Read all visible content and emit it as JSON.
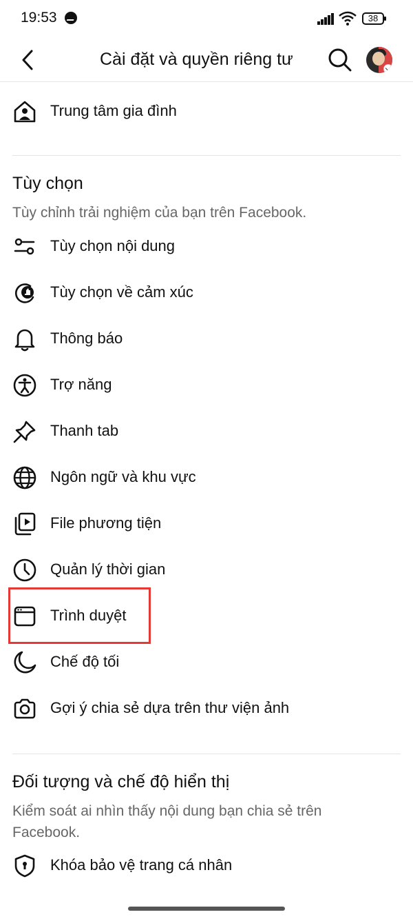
{
  "status_bar": {
    "time": "19:53",
    "battery": "38"
  },
  "header": {
    "title": "Cài đặt và quyền riêng tư"
  },
  "family_center": {
    "label": "Trung tâm gia đình"
  },
  "preferences": {
    "title": "Tùy chọn",
    "description": "Tùy chỉnh trải nghiệm của bạn trên Facebook.",
    "items": [
      {
        "label": "Tùy chọn nội dung",
        "icon": "sliders-icon"
      },
      {
        "label": "Tùy chọn về cảm xúc",
        "icon": "reaction-icon"
      },
      {
        "label": "Thông báo",
        "icon": "bell-icon"
      },
      {
        "label": "Trợ năng",
        "icon": "accessibility-icon"
      },
      {
        "label": "Thanh tab",
        "icon": "pin-icon"
      },
      {
        "label": "Ngôn ngữ và khu vực",
        "icon": "globe-icon"
      },
      {
        "label": "File phương tiện",
        "icon": "media-icon"
      },
      {
        "label": "Quản lý thời gian",
        "icon": "clock-icon"
      },
      {
        "label": "Trình duyệt",
        "icon": "browser-icon"
      },
      {
        "label": "Chế độ tối",
        "icon": "moon-icon"
      },
      {
        "label": "Gợi ý chia sẻ dựa trên thư viện ảnh",
        "icon": "camera-icon"
      }
    ]
  },
  "audience": {
    "title": "Đối tượng và chế độ hiển thị",
    "description": "Kiểm soát ai nhìn thấy nội dung bạn chia sẻ trên Facebook.",
    "items": [
      {
        "label": "Khóa bảo vệ trang cá nhân",
        "icon": "shield-lock-icon"
      }
    ]
  },
  "colors": {
    "highlight": "#e53935",
    "text": "#111111",
    "muted": "#666666"
  }
}
